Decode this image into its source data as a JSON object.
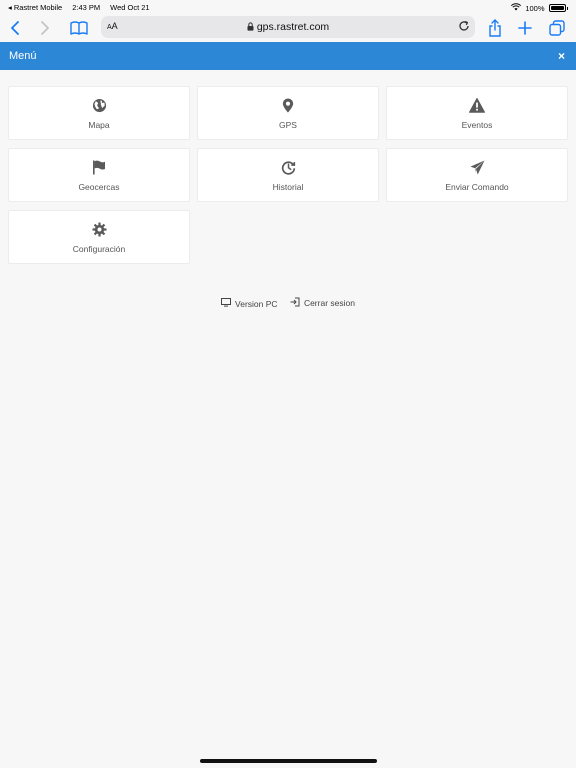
{
  "status_bar": {
    "carrier": "◂ Rastret Mobile",
    "time": "2:43 PM",
    "date": "Wed Oct 21",
    "battery": "100%"
  },
  "browser": {
    "text_size_label_small": "A",
    "text_size_label_large": "A",
    "url": "gps.rastret.com",
    "accent_color": "#1a7cf5"
  },
  "menu": {
    "title": "Menú",
    "close": "×",
    "header_color": "#2d87d7"
  },
  "tiles": [
    {
      "label": "Mapa",
      "icon": "globe-icon"
    },
    {
      "label": "GPS",
      "icon": "map-marker-icon"
    },
    {
      "label": "Eventos",
      "icon": "warning-icon"
    },
    {
      "label": "Geocercas",
      "icon": "flag-icon"
    },
    {
      "label": "Historial",
      "icon": "history-icon"
    },
    {
      "label": "Enviar Comando",
      "icon": "paper-plane-icon"
    },
    {
      "label": "Configuración",
      "icon": "gear-icon"
    }
  ],
  "footer": {
    "version_pc": "Version PC",
    "logout": "Cerrar sesion"
  }
}
